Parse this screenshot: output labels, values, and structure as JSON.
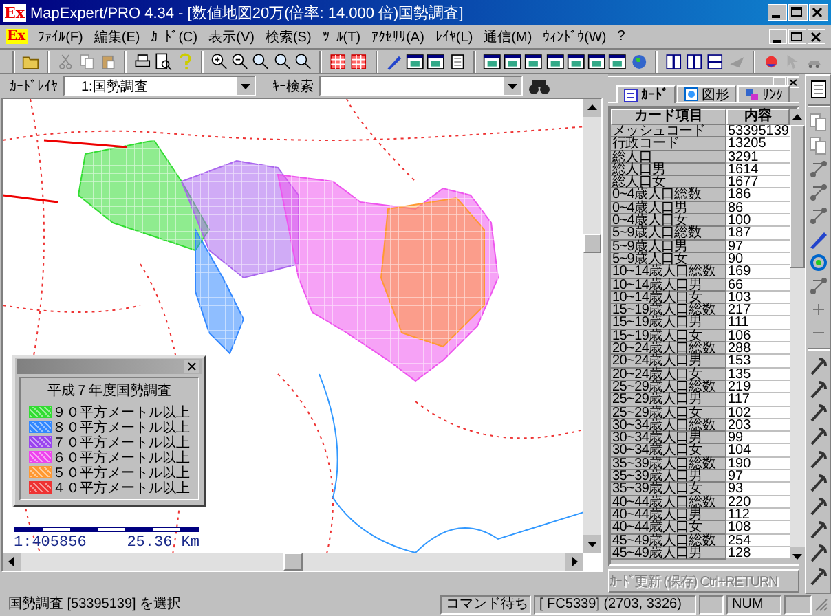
{
  "window": {
    "logo": "Ex",
    "title": "MapExpert/PRO 4.34 - [数値地図20万(倍率: 14.000 倍)国勢調査]"
  },
  "menu": {
    "logo": "Ex",
    "items": [
      "ﾌｧｲﾙ(F)",
      "編集(E)",
      "ｶｰﾄﾞ(C)",
      "表示(V)",
      "検索(S)",
      "ﾂｰﾙ(T)",
      "ｱｸｾｻﾘ(A)",
      "ﾚｲﾔ(L)",
      "通信(M)",
      "ｳｨﾝﾄﾞｳ(W)",
      "?"
    ]
  },
  "layer_bar": {
    "layer_label": "ｶｰﾄﾞﾚｲﾔ",
    "layer_value": "1:国勢調査",
    "search_label": "ｷｰ検索"
  },
  "legend": {
    "title": "平成７年度国勢調査",
    "items": [
      {
        "label": "９０平方メートル以上",
        "color": "#33dd33"
      },
      {
        "label": "８０平方メートル以上",
        "color": "#3388ff"
      },
      {
        "label": "７０平方メートル以上",
        "color": "#9944ee"
      },
      {
        "label": "６０平方メートル以上",
        "color": "#ee44ee"
      },
      {
        "label": "５０平方メートル以上",
        "color": "#ff9933"
      },
      {
        "label": "４０平方メートル以上",
        "color": "#ee3333"
      }
    ]
  },
  "scale": {
    "ratio": "1:405856",
    "distance": "25.36 Km"
  },
  "card_panel": {
    "tabs": [
      {
        "label": "ｶｰﾄﾞ",
        "selected": true
      },
      {
        "label": "図形",
        "selected": false
      },
      {
        "label": "ﾘﾝｸ",
        "selected": false
      }
    ],
    "columns": [
      "カード項目",
      "内容"
    ],
    "rows": [
      [
        "メッシュコード",
        "53395139"
      ],
      [
        "行政コード",
        "13205"
      ],
      [
        "総人口",
        "3291"
      ],
      [
        "総人口男",
        "1614"
      ],
      [
        "総人口女",
        "1677"
      ],
      [
        "0~4歳人口総数",
        "186"
      ],
      [
        "0~4歳人口男",
        "86"
      ],
      [
        "0~4歳人口女",
        "100"
      ],
      [
        "5~9歳人口総数",
        "187"
      ],
      [
        "5~9歳人口男",
        "97"
      ],
      [
        "5~9歳人口女",
        "90"
      ],
      [
        "10~14歳人口総数",
        "169"
      ],
      [
        "10~14歳人口男",
        "66"
      ],
      [
        "10~14歳人口女",
        "103"
      ],
      [
        "15~19歳人口総数",
        "217"
      ],
      [
        "15~19歳人口男",
        "111"
      ],
      [
        "15~19歳人口女",
        "106"
      ],
      [
        "20~24歳人口総数",
        "288"
      ],
      [
        "20~24歳人口男",
        "153"
      ],
      [
        "20~24歳人口女",
        "135"
      ],
      [
        "25~29歳人口総数",
        "219"
      ],
      [
        "25~29歳人口男",
        "117"
      ],
      [
        "25~29歳人口女",
        "102"
      ],
      [
        "30~34歳人口総数",
        "203"
      ],
      [
        "30~34歳人口男",
        "99"
      ],
      [
        "30~34歳人口女",
        "104"
      ],
      [
        "35~39歳人口総数",
        "190"
      ],
      [
        "35~39歳人口男",
        "97"
      ],
      [
        "35~39歳人口女",
        "93"
      ],
      [
        "40~44歳人口総数",
        "220"
      ],
      [
        "40~44歳人口男",
        "112"
      ],
      [
        "40~44歳人口女",
        "108"
      ],
      [
        "45~49歳人口総数",
        "254"
      ],
      [
        "45~49歳人口男",
        "128"
      ]
    ],
    "button": {
      "label": "ｶｰﾄﾞ更新 (保存)  Ctrl+RETURN",
      "disabled": true
    }
  },
  "status_bar": {
    "message": "国勢調査 [53395139] を選択",
    "mode": "コマンド待ち",
    "coords": "[ FC5339] (2703, 3326)",
    "num": "NUM"
  }
}
